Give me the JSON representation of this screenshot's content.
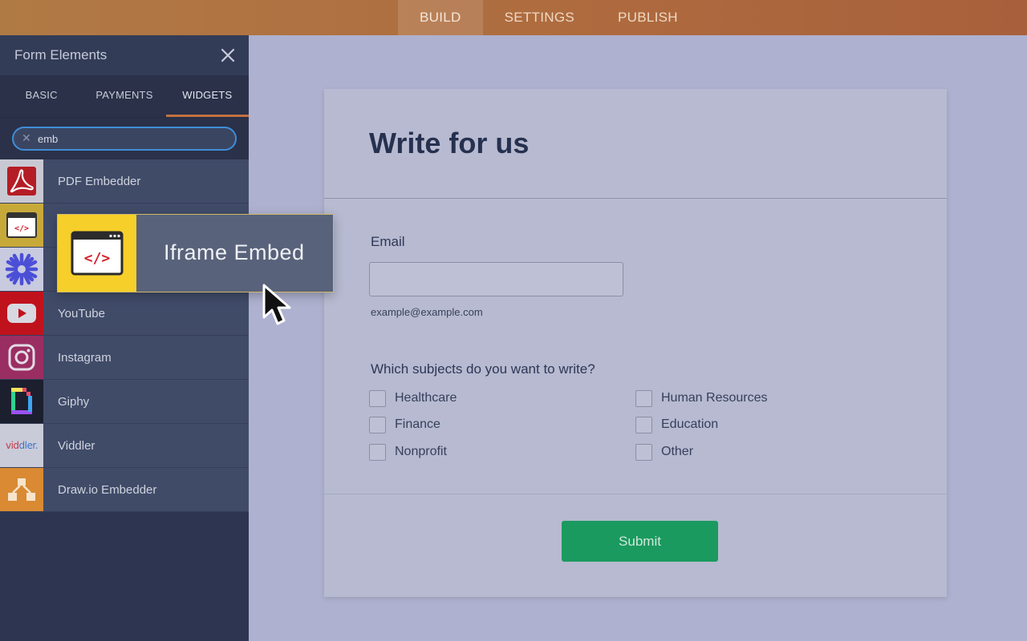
{
  "topnav": {
    "tabs": [
      "BUILD",
      "SETTINGS",
      "PUBLISH"
    ],
    "active": "BUILD"
  },
  "sidebar": {
    "title": "Form Elements",
    "tabs": [
      "BASIC",
      "PAYMENTS",
      "WIDGETS"
    ],
    "active_tab": "WIDGETS",
    "search": {
      "value": "emb"
    },
    "items": [
      {
        "label": "PDF Embedder",
        "icon": "pdf-icon"
      },
      {
        "label": "",
        "icon": "code-window-icon"
      },
      {
        "label": "",
        "icon": "sunburst-icon"
      },
      {
        "label": "YouTube",
        "icon": "youtube-icon"
      },
      {
        "label": "Instagram",
        "icon": "instagram-icon"
      },
      {
        "label": "Giphy",
        "icon": "giphy-icon"
      },
      {
        "label": "Viddler",
        "icon": "viddler-logo"
      },
      {
        "label": "Draw.io Embedder",
        "icon": "diagram-icon"
      }
    ]
  },
  "drag": {
    "label": "Iframe Embed",
    "icon": "code-window-icon"
  },
  "form": {
    "title": "Write for us",
    "email_label": "Email",
    "email_value": "",
    "email_hint": "example@example.com",
    "question": "Which subjects do you want to write?",
    "options": [
      "Healthcare",
      "Human Resources",
      "Finance",
      "Education",
      "Nonprofit",
      "Other"
    ],
    "submit": "Submit"
  },
  "colors": {
    "topbar": "#ae6a3e",
    "sidebar": "#2d3550",
    "canvas": "#aeb1cf",
    "accent_tab": "#c2713f",
    "search_border": "#3f8ed8",
    "submit": "#1a9a5f",
    "drag_icon_bg": "#f6cf2a"
  }
}
